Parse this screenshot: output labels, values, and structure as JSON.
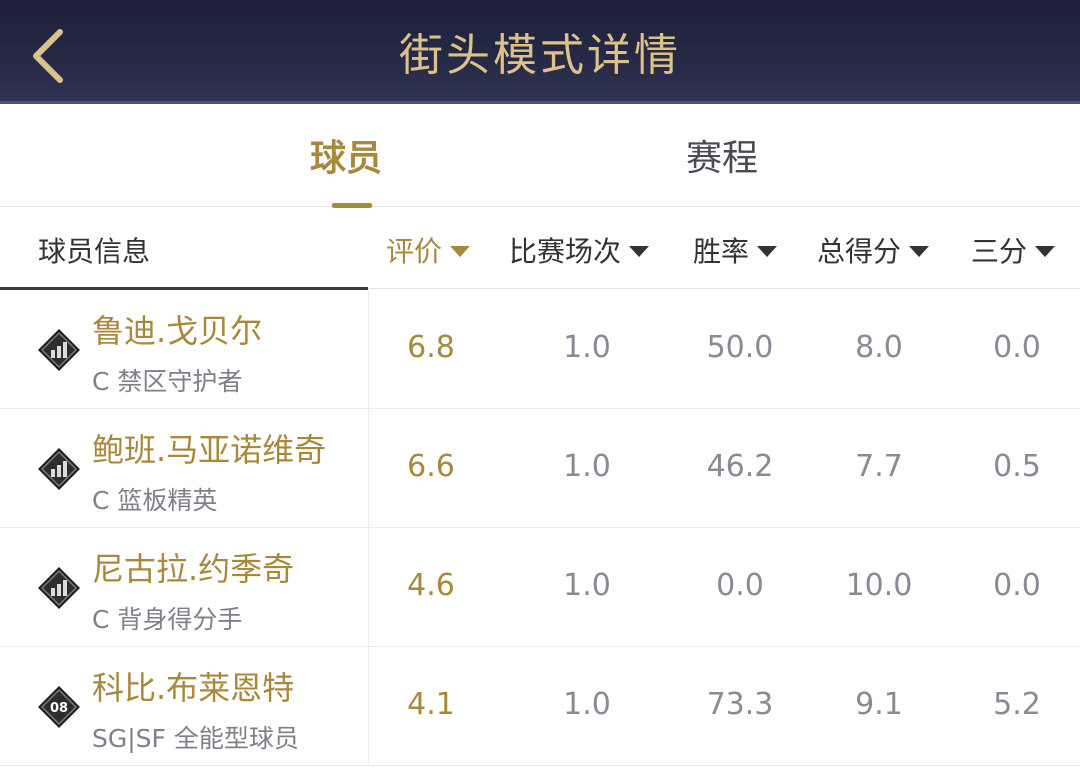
{
  "header": {
    "title": "街头模式详情",
    "back_icon": "chevron-left-icon",
    "title_color": "#dcc28a"
  },
  "tabs": [
    {
      "label": "球员",
      "active": true
    },
    {
      "label": "赛程",
      "active": false
    }
  ],
  "columns": {
    "info": "球员信息",
    "sortable": [
      {
        "label": "评价",
        "active": true
      },
      {
        "label": "比赛场次",
        "active": false
      },
      {
        "label": "胜率",
        "active": false
      },
      {
        "label": "总得分",
        "active": false
      },
      {
        "label": "三分",
        "active": false
      }
    ]
  },
  "players": [
    {
      "name": "鲁迪.戈贝尔",
      "role": "C 禁区守护者",
      "badge": "bar-chart-badge-icon",
      "badge_text": "",
      "rating": "6.8",
      "games": "1.0",
      "win_rate": "50.0",
      "points": "8.0",
      "threes": "0.0"
    },
    {
      "name": "鲍班.马亚诺维奇",
      "role": "C 篮板精英",
      "badge": "bar-chart-badge-icon",
      "badge_text": "",
      "rating": "6.6",
      "games": "1.0",
      "win_rate": "46.2",
      "points": "7.7",
      "threes": "0.5"
    },
    {
      "name": "尼古拉.约季奇",
      "role": "C 背身得分手",
      "badge": "bar-chart-badge-icon",
      "badge_text": "",
      "rating": "4.6",
      "games": "1.0",
      "win_rate": "0.0",
      "points": "10.0",
      "threes": "0.0"
    },
    {
      "name": "科比.布莱恩特",
      "role": "SG|SF 全能型球员",
      "badge": "number-badge-icon",
      "badge_text": "08",
      "rating": "4.1",
      "games": "1.0",
      "win_rate": "73.3",
      "points": "9.1",
      "threes": "5.2"
    }
  ],
  "colors": {
    "accent": "#a8893c",
    "header_bg": "#262a46",
    "muted": "#8a8a94"
  }
}
